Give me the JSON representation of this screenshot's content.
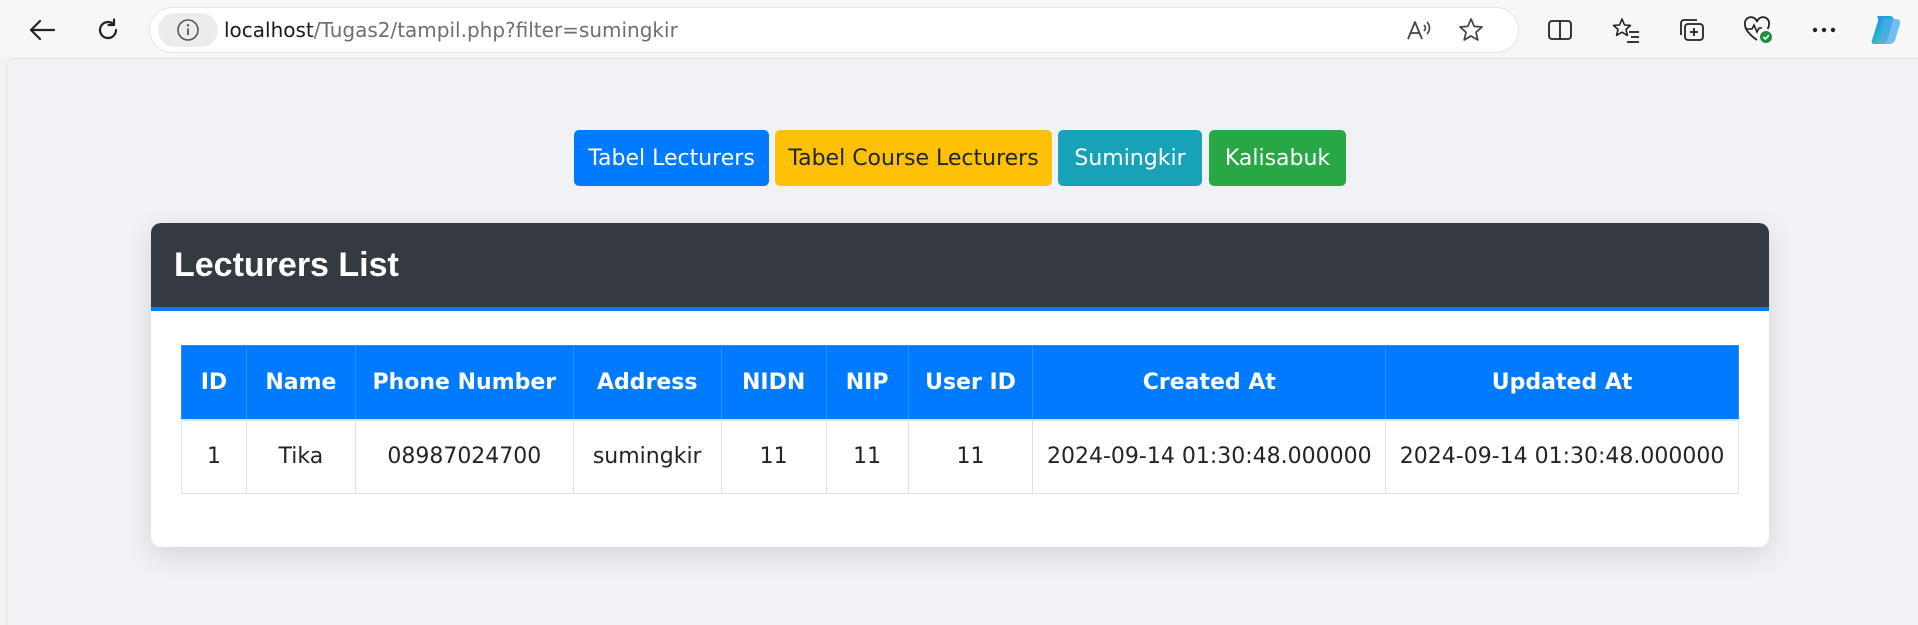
{
  "browser": {
    "url_host": "localhost",
    "url_path": "/Tugas2/tampil.php?filter=sumingkir",
    "icons": {
      "back": "back-arrow-icon",
      "reload": "reload-icon",
      "site_info": "info-icon",
      "read_aloud": "read-aloud-icon",
      "favorite": "star-icon",
      "split_screen": "split-screen-icon",
      "favorites": "favorites-list-icon",
      "collections": "collections-icon",
      "health": "browser-essentials-icon",
      "more": "more-icon",
      "copilot": "copilot-icon"
    }
  },
  "nav_buttons": [
    {
      "label": "Tabel Lecturers",
      "color": "#007bff"
    },
    {
      "label": "Tabel Course Lecturers",
      "color": "#ffc107"
    },
    {
      "label": "Sumingkir",
      "color": "#17a2b8"
    },
    {
      "label": "Kalisabuk",
      "color": "#28a745"
    }
  ],
  "card": {
    "title": "Lecturers List",
    "header_bg": "#343a40",
    "accent": "#007bff"
  },
  "table": {
    "columns": [
      "ID",
      "Name",
      "Phone Number",
      "Address",
      "NIDN",
      "NIP",
      "User ID",
      "Created At",
      "Updated At"
    ],
    "rows": [
      [
        "1",
        "Tika",
        "08987024700",
        "sumingkir",
        "11",
        "11",
        "11",
        "2024-09-14 01:30:48.000000",
        "2024-09-14 01:30:48.000000"
      ]
    ]
  }
}
